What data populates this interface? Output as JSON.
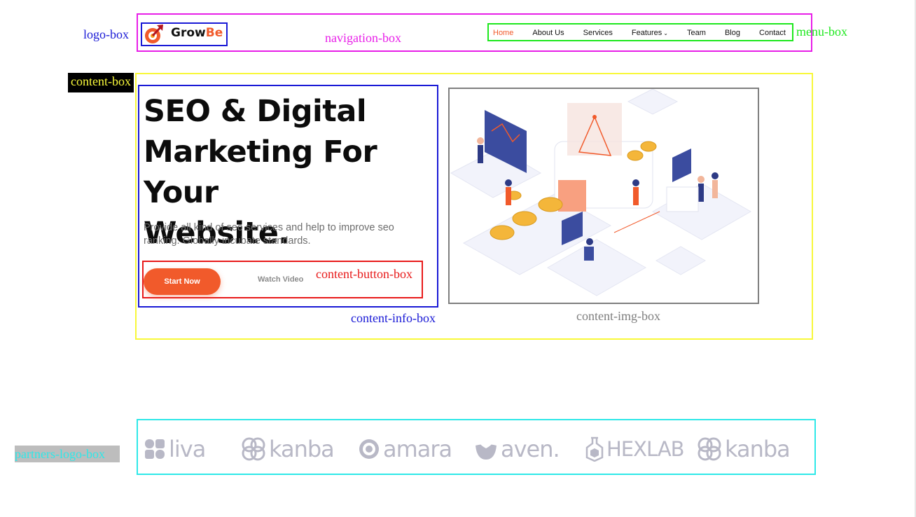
{
  "annotations": {
    "logo_box": "logo-box",
    "navigation_box": "navigation-box",
    "menu_box": "menu-box",
    "content_box": "content-box",
    "content_button_box": "content-button-box",
    "content_info_box": "content-info-box",
    "content_img_box": "content-img-box",
    "partners_logo_box": "partners-logo-box"
  },
  "colors": {
    "accent": "#f15a2b",
    "navigation_box": "#e81ee8",
    "logo_box": "#1a1ad6",
    "menu_box": "#1ee81e",
    "content_box": "#f8f83a",
    "content_button_box": "#e81a1a",
    "content_img_box": "#7f7f7f",
    "partners_logo_box": "#2ee8e8"
  },
  "logo": {
    "text_main": "Grow",
    "text_accent": "Be",
    "icon": "rocket-arrow-icon"
  },
  "menu": {
    "items": [
      "Home",
      "About Us",
      "Services",
      "Features",
      "Team",
      "Blog",
      "Contact"
    ],
    "active": "Home",
    "dropdown_icon": "chevron-down-icon"
  },
  "hero": {
    "title_line1": "SEO & Digital",
    "title_line2": "Marketing For Your",
    "title_line3": "Website.",
    "description": "Provide all kind of seo services and help to improve seo ranking. Globally incubate standards.",
    "start_button": "Start Now",
    "watch_button": "Watch Video"
  },
  "partners": {
    "logos": [
      {
        "name": "liva",
        "icon": "four-petal-icon"
      },
      {
        "name": "kanba",
        "icon": "interlocked-rings-icon"
      },
      {
        "name": "amara",
        "icon": "at-sign-icon"
      },
      {
        "name": "aven.",
        "icon": "heart-cup-icon"
      },
      {
        "name": "HEXLAB",
        "icon": "flask-hexagon-icon"
      },
      {
        "name": "kanba",
        "icon": "interlocked-rings-icon"
      }
    ]
  }
}
